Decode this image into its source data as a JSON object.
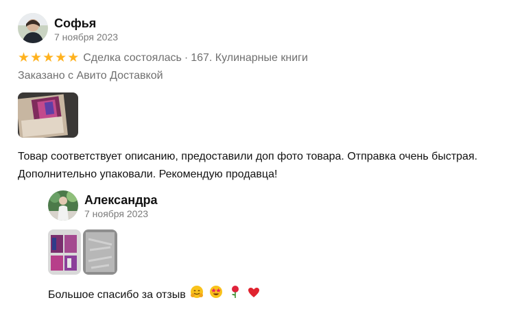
{
  "review": {
    "author": "Софья",
    "date": "7 ноября 2023",
    "rating": 5,
    "stars": [
      "★",
      "★",
      "★",
      "★",
      "★"
    ],
    "deal_status": "Сделка состоялась",
    "separator": "·",
    "item": "167. Кулинарные книги",
    "delivery": "Заказано с Авито Доставкой",
    "photos_count": 1,
    "text_line1": "Товар соответствует описанию, предоставили доп фото товара. Отправка очень быстрая.",
    "text_line2": "Дополнительно упаковали. Рекомендую продавца!"
  },
  "reply": {
    "author": "Александра",
    "date": "7 ноября 2023",
    "photos_count": 2,
    "text": "Большое спасибо за отзыв",
    "emojis": [
      "hugging-face-icon",
      "star-struck-face-icon",
      "rose-icon",
      "red-heart-icon"
    ]
  },
  "colors": {
    "star": "#ffb21e",
    "meta": "#6f6f6f",
    "date": "#7a7a7a",
    "heart": "#e0232f"
  }
}
